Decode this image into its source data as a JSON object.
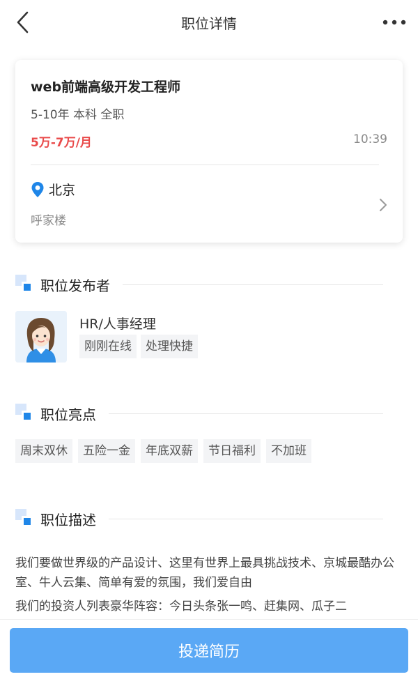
{
  "nav": {
    "title": "职位详情",
    "back_icon": "chevron-left-icon",
    "more_icon": "more-horizontal-icon"
  },
  "job": {
    "title": "web前端高级开发工程师",
    "meta": "5-10年 本科 全职",
    "salary": "5万-7万/月",
    "time": "10:39",
    "city": "北京",
    "address": "呼家楼"
  },
  "sections": {
    "publisher": "职位发布者",
    "highlights": "职位亮点",
    "description": "职位描述"
  },
  "publisher": {
    "name": "HR/人事经理",
    "tags": [
      "刚刚在线",
      "处理快捷"
    ]
  },
  "highlights": [
    "周末双休",
    "五险一金",
    "年底双薪",
    "节日福利",
    "不加班"
  ],
  "description": [
    "我们要做世界级的产品设计、这里有世界上最具挑战技术、京城最酷办公室、牛人云集、简单有爱的氛围，我们爱自由",
    "我们的投资人列表豪华阵容：今日头条张一鸣、赶集网、瓜子二"
  ],
  "apply_button": "投递简历",
  "colors": {
    "accent": "#1f86e8",
    "salary": "#e94a4a",
    "button": "#5aa8f5"
  }
}
